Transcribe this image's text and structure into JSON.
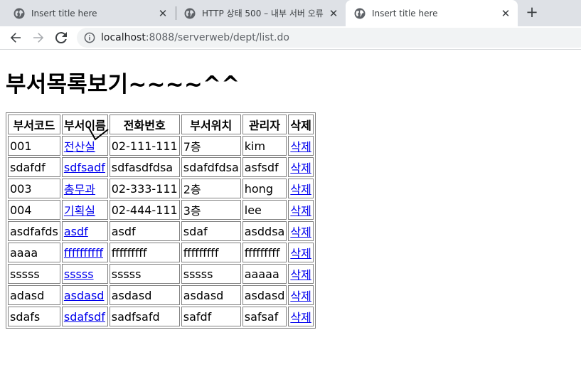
{
  "browser": {
    "tabs": [
      {
        "title": "Insert title here",
        "active": false
      },
      {
        "title": "HTTP 상태 500 – 내부 서버 오류",
        "active": false
      },
      {
        "title": "Insert title here",
        "active": true
      }
    ],
    "close_glyph": "✕",
    "new_tab_glyph": "+",
    "url": {
      "host": "localhost",
      "path": ":8088/serverweb/dept/list.do"
    }
  },
  "page": {
    "heading": "부서목록보기~~~~^^",
    "table": {
      "headers": [
        "부서코드",
        "부서이름",
        "전화번호",
        "부서위치",
        "관리자",
        "삭제"
      ],
      "rows": [
        {
          "code": "001",
          "name": "전산실",
          "phone": "02-111-111",
          "location": "7층",
          "manager": "kim",
          "delete": "삭제"
        },
        {
          "code": "sdafdf",
          "name": "sdfsadf",
          "phone": "sdfasdfdsa",
          "location": "sdafdfdsa",
          "manager": "asfsdf",
          "delete": "삭제"
        },
        {
          "code": "003",
          "name": "총무과",
          "phone": "02-333-111",
          "location": "2층",
          "manager": "hong",
          "delete": "삭제"
        },
        {
          "code": "004",
          "name": "기획실",
          "phone": "02-444-111",
          "location": "3층",
          "manager": "lee",
          "delete": "삭제"
        },
        {
          "code": "asdfafds",
          "name": "asdf",
          "phone": "asdf",
          "location": "sdaf",
          "manager": "asddsa",
          "delete": "삭제"
        },
        {
          "code": "aaaa",
          "name": "ffffffffff",
          "phone": "fffffffff",
          "location": "fffffffff",
          "manager": "fffffffff",
          "delete": "삭제"
        },
        {
          "code": "sssss",
          "name": "sssss",
          "phone": "sssss",
          "location": "sssss",
          "manager": "aaaaa",
          "delete": "삭제"
        },
        {
          "code": "adasd",
          "name": "asdasd",
          "phone": "asdasd",
          "location": "asdasd",
          "manager": "asdasd",
          "delete": "삭제"
        },
        {
          "code": "sdafs",
          "name": "sdafsdf",
          "phone": "sadfsafd",
          "location": "safdf",
          "manager": "safsaf",
          "delete": "삭제"
        }
      ]
    }
  },
  "icons": {
    "favicon": "globe-icon",
    "back": "arrow-left-icon",
    "forward": "arrow-right-icon",
    "reload": "reload-icon",
    "site_info": "info-icon",
    "pointer": "mouse-cursor-icon"
  },
  "colors": {
    "tabbar": "#dee1e6",
    "omnibox": "#f1f3f4",
    "link": "#0000ee",
    "table_border": "#808080"
  }
}
